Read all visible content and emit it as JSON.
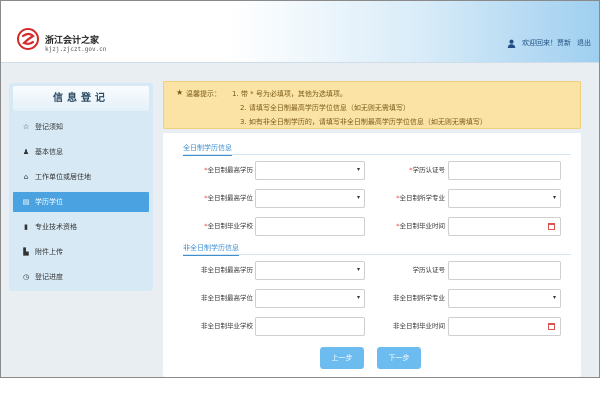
{
  "header": {
    "site_name": "浙江会计之家",
    "site_url": "kjzj.zjczt.gov.cn",
    "user_greeting": "欢迎回来！",
    "username": "贾新",
    "logout": "退出"
  },
  "sidebar": {
    "title": "信息登记",
    "items": [
      {
        "label": "登记须知",
        "icon": "star-icon"
      },
      {
        "label": "基本信息",
        "icon": "user-icon"
      },
      {
        "label": "工作单位或居住地",
        "icon": "home-icon"
      },
      {
        "label": "学历学位",
        "icon": "list-icon",
        "active": true
      },
      {
        "label": "专业技术资格",
        "icon": "book-icon"
      },
      {
        "label": "附件上传",
        "icon": "file-icon"
      },
      {
        "label": "登记进度",
        "icon": "clock-icon"
      }
    ]
  },
  "notice": {
    "label": "温馨提示：",
    "lines": [
      "1. 带 * 号为必填项，其他为选填项。",
      "2. 请填写全日制最高学历学位信息（如无则无需填写）",
      "3. 如有非全日制学历的，请填写非全日制最高学历学位信息（如无则无需填写）"
    ]
  },
  "form": {
    "fulltime_section": "全日制学历信息",
    "parttime_section": "非全日制学历信息",
    "fulltime": {
      "edu_label": "全日制最高学历",
      "cert_label": "学历认证号",
      "degree_label": "全日制最高学位",
      "major_label": "全日制所学专业",
      "school_label": "全日制毕业学校",
      "grad_time_label": "全日制毕业时间"
    },
    "parttime": {
      "edu_label": "非全日制最高学历",
      "cert_label": "学历认证号",
      "degree_label": "非全日制最高学位",
      "major_label": "非全日制所学专业",
      "school_label": "非全日制毕业学校",
      "grad_time_label": "非全日制毕业时间"
    },
    "prev_button": "上一步",
    "next_button": "下一步"
  },
  "colors": {
    "accent": "#4aa3e0",
    "button": "#6cbcf0",
    "notice_bg": "#fbe3a6",
    "required": "#e44444"
  }
}
